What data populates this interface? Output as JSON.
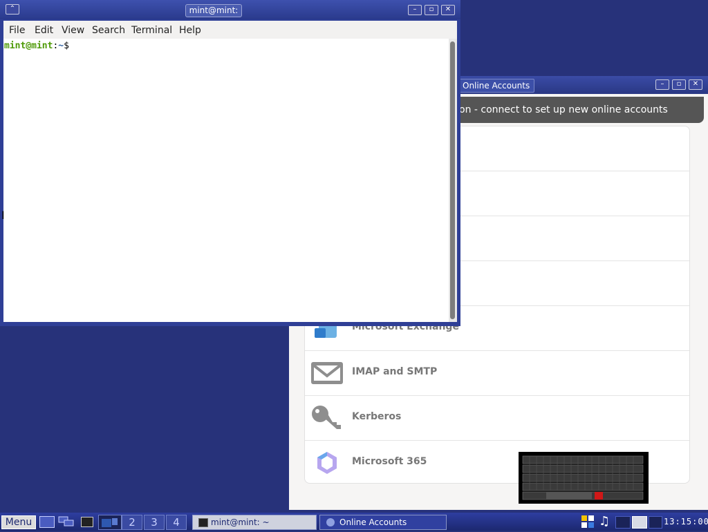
{
  "terminal": {
    "title": "mint@mint: ~",
    "menu": [
      "File",
      "Edit",
      "View",
      "Search",
      "Terminal",
      "Help"
    ],
    "prompt_user": "mint@mint",
    "prompt_sep": ":",
    "prompt_path": "~",
    "prompt_symbol": "$"
  },
  "online_accounts": {
    "title": "Online Accounts",
    "banner": "on - connect to set up new online accounts",
    "providers": [
      {
        "label": "Microsoft Exchange",
        "icon": "exchange-icon"
      },
      {
        "label": "IMAP and SMTP",
        "icon": "mail-icon"
      },
      {
        "label": "Kerberos",
        "icon": "key-icon"
      },
      {
        "label": "Microsoft 365",
        "icon": "microsoft365-icon"
      }
    ]
  },
  "taskbar": {
    "menu_label": "Menu",
    "workspaces": [
      "2",
      "3",
      "4"
    ],
    "tasks": [
      {
        "label": "mint@mint: ~",
        "icon": "terminal-icon"
      },
      {
        "label": "Online Accounts",
        "icon": "online-accounts-icon"
      }
    ],
    "clock": "13:15:00"
  },
  "colors": {
    "desktop": "#27327a",
    "prompt_green": "#4e9a06",
    "prompt_blue": "#3465a4"
  }
}
